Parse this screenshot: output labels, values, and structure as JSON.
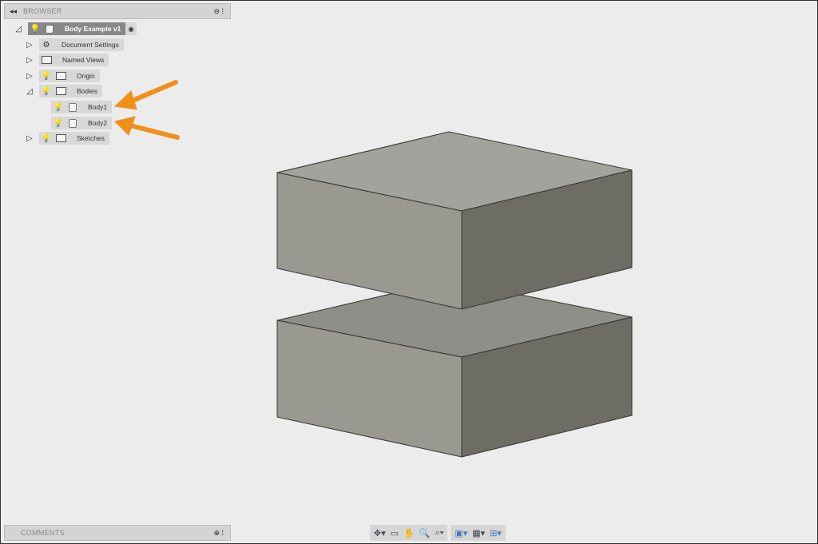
{
  "browser": {
    "title": "BROWSER",
    "root": "Body Example v1",
    "items": [
      {
        "label": "Document Settings"
      },
      {
        "label": "Named Views"
      },
      {
        "label": "Origin"
      },
      {
        "label": "Bodies"
      },
      {
        "label": "Body1"
      },
      {
        "label": "Body2"
      },
      {
        "label": "Sketches"
      }
    ]
  },
  "comments": {
    "title": "COMMENTS"
  },
  "toolbar": {
    "icons": [
      "orbit-icon",
      "look-at-icon",
      "pan-icon",
      "zoom-icon",
      "fit-icon",
      "display-settings-icon",
      "grid-icon",
      "viewports-icon"
    ]
  },
  "colors": {
    "arrow": "#f0901a",
    "box_top": "#a3a39d",
    "box_front": "#999992",
    "box_side": "#6d6d66"
  }
}
